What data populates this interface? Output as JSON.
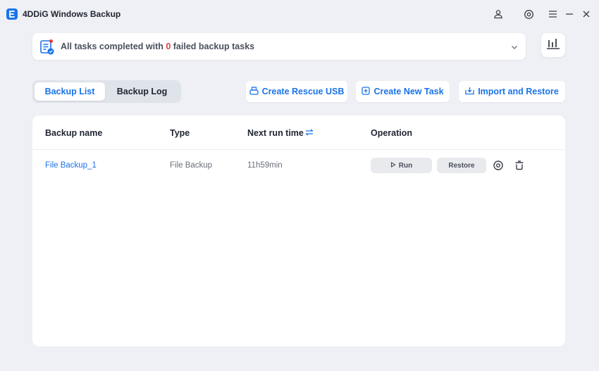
{
  "app": {
    "title": "4DDiG Windows Backup"
  },
  "status": {
    "prefix": "All tasks completed with ",
    "failed_count": "0",
    "suffix": " failed backup tasks"
  },
  "tabs": [
    {
      "label": "Backup List",
      "active": true
    },
    {
      "label": "Backup Log",
      "active": false
    }
  ],
  "actions": {
    "rescue_usb": "Create Rescue USB",
    "new_task": "Create New Task",
    "import_restore": "Import and Restore"
  },
  "table": {
    "headers": {
      "name": "Backup name",
      "type": "Type",
      "next_run": "Next run time",
      "operation": "Operation"
    },
    "rows": [
      {
        "name": "File Backup_1",
        "type": "File Backup",
        "next_run": "11h59min",
        "run_label": "Run",
        "restore_label": "Restore"
      }
    ]
  },
  "colors": {
    "accent": "#1a73e8",
    "danger": "#e23c3c",
    "background": "#eef0f5"
  },
  "icons": [
    "app-logo-icon",
    "user-icon",
    "settings-icon",
    "menu-icon",
    "minimize-icon",
    "close-icon",
    "task-status-icon",
    "chevron-down-icon",
    "chart-icon",
    "usb-icon",
    "add-task-icon",
    "import-icon",
    "sort-icon",
    "play-icon",
    "gear-icon",
    "delete-icon"
  ]
}
